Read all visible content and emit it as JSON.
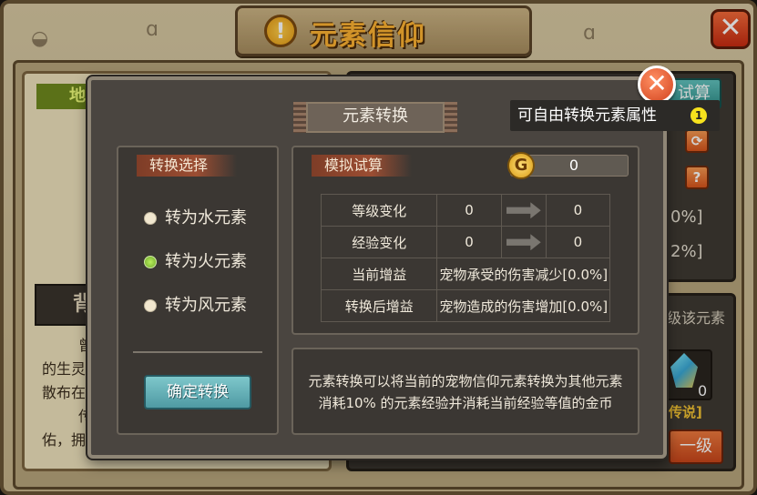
{
  "window": {
    "title": "元素信仰",
    "title_icon": "exclamation-icon"
  },
  "background": {
    "earth_tab": "地",
    "back_label": "背",
    "desc_lines": [
      "曾",
      "的生灵",
      "散布在",
      "传",
      "佑，拥"
    ],
    "calc_button": "试算",
    "pct_1": "0%]",
    "pct_2": "2%]",
    "upgrade_desc": "级该元素",
    "crystal_count": "0",
    "legend_label": "传说]",
    "upgrade_button": "一级"
  },
  "tooltip": {
    "text": "可自由转换元素属性",
    "badge": "1"
  },
  "modal": {
    "title": "元素转换",
    "convert_select_label": "转换选择",
    "options": [
      {
        "label": "转为水元素",
        "selected": false
      },
      {
        "label": "转为火元素",
        "selected": true
      },
      {
        "label": "转为风元素",
        "selected": false
      }
    ],
    "confirm_button": "确定转换",
    "simulate_label": "模拟试算",
    "gold_value": "0",
    "gold_icon": "G",
    "rows": [
      {
        "name": "等级变化",
        "from": "0",
        "to": "0"
      },
      {
        "name": "经验变化",
        "from": "0",
        "to": "0"
      },
      {
        "name": "当前增益",
        "value": "宠物承受的伤害减少[0.0%]"
      },
      {
        "name": "转换后增益",
        "value": "宠物造成的伤害增加[0.0%]"
      }
    ],
    "description": [
      "元素转换可以将当前的宠物信仰元素转换为其他元素",
      "消耗10% 的元素经验并消耗当前经验等值的金币"
    ]
  },
  "colors": {
    "title_text": "#ffb432",
    "modal_bg": "#4a4540",
    "confirm_btn": "#6fb7bc",
    "selected_radio": "#8fd23f",
    "tag_bg": "#8a432b"
  }
}
